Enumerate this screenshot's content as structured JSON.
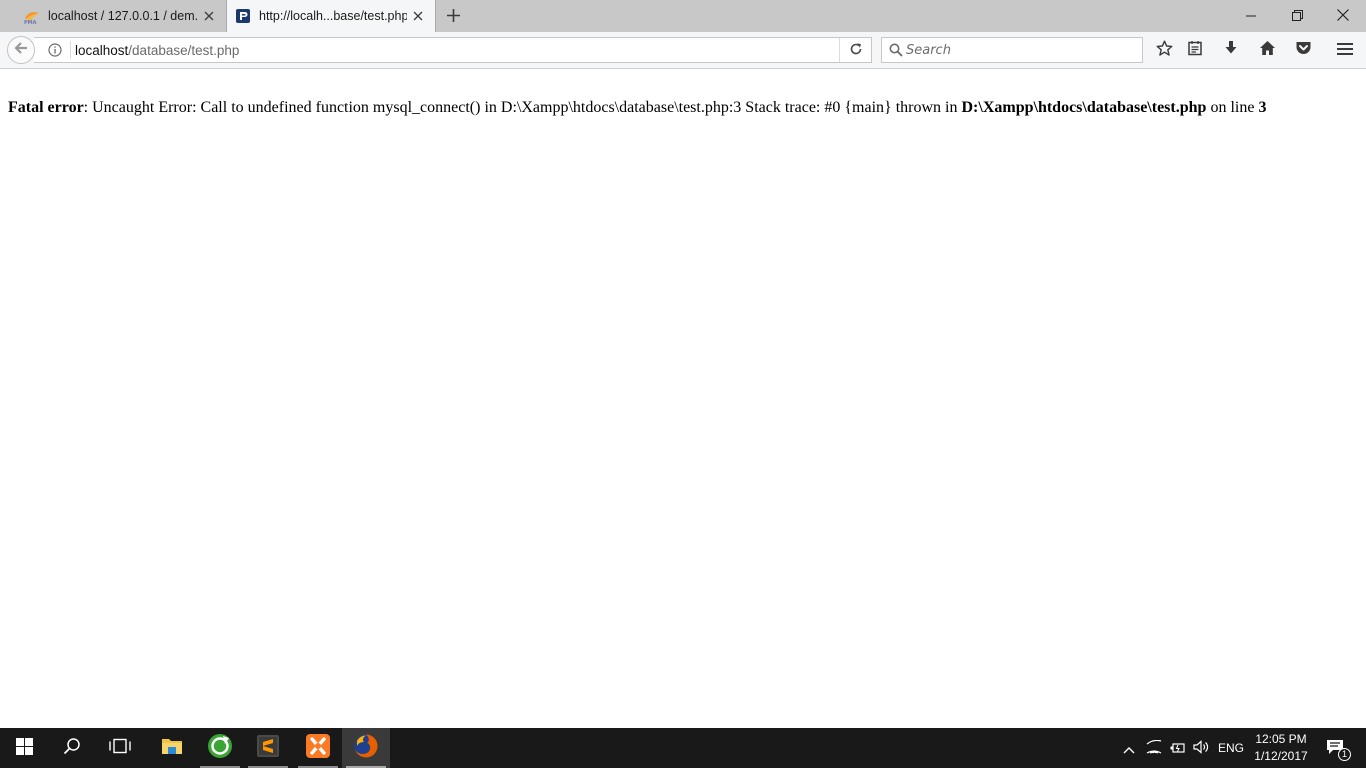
{
  "browser": {
    "tabs": [
      {
        "title": "localhost / 127.0.0.1 / dem...",
        "favicon": "phpmyadmin-icon",
        "active": false
      },
      {
        "title": "http://localh...base/test.php",
        "favicon": "php-page-icon",
        "active": true
      }
    ],
    "window_controls": {
      "minimize": "minimize-icon",
      "restore": "restore-icon",
      "close": "close-icon"
    },
    "address_bar": {
      "host": "localhost",
      "path": "/database/test.php"
    },
    "search_bar": {
      "placeholder": "Search"
    },
    "toolbar_icons": [
      "bookmark-star-icon",
      "reading-list-icon",
      "download-icon",
      "home-icon",
      "pocket-icon",
      "menu-icon"
    ]
  },
  "page": {
    "error": {
      "label": "Fatal error",
      "message": ": Uncaught Error: Call to undefined function mysql_connect() in D:\\Xampp\\htdocs\\database\\test.php:3 Stack trace: #0 {main} thrown in ",
      "file": "D:\\Xampp\\htdocs\\database\\test.php",
      "line_prefix": " on line ",
      "line": "3"
    }
  },
  "taskbar": {
    "apps": [
      "windows-start-icon",
      "search-icon",
      "task-view-icon",
      "file-explorer-icon",
      "browser-green-icon",
      "sublime-text-icon",
      "xampp-icon",
      "firefox-icon"
    ],
    "tray": {
      "language": "ENG",
      "time": "12:05 PM",
      "date": "1/12/2017",
      "notification_count": "1"
    }
  },
  "colors": {
    "tabstrip": "#c8c8c8",
    "toolbar": "#f5f6f7",
    "taskbar": "#191919",
    "xampp": "#fb7a24",
    "firefox": "#e66000"
  }
}
